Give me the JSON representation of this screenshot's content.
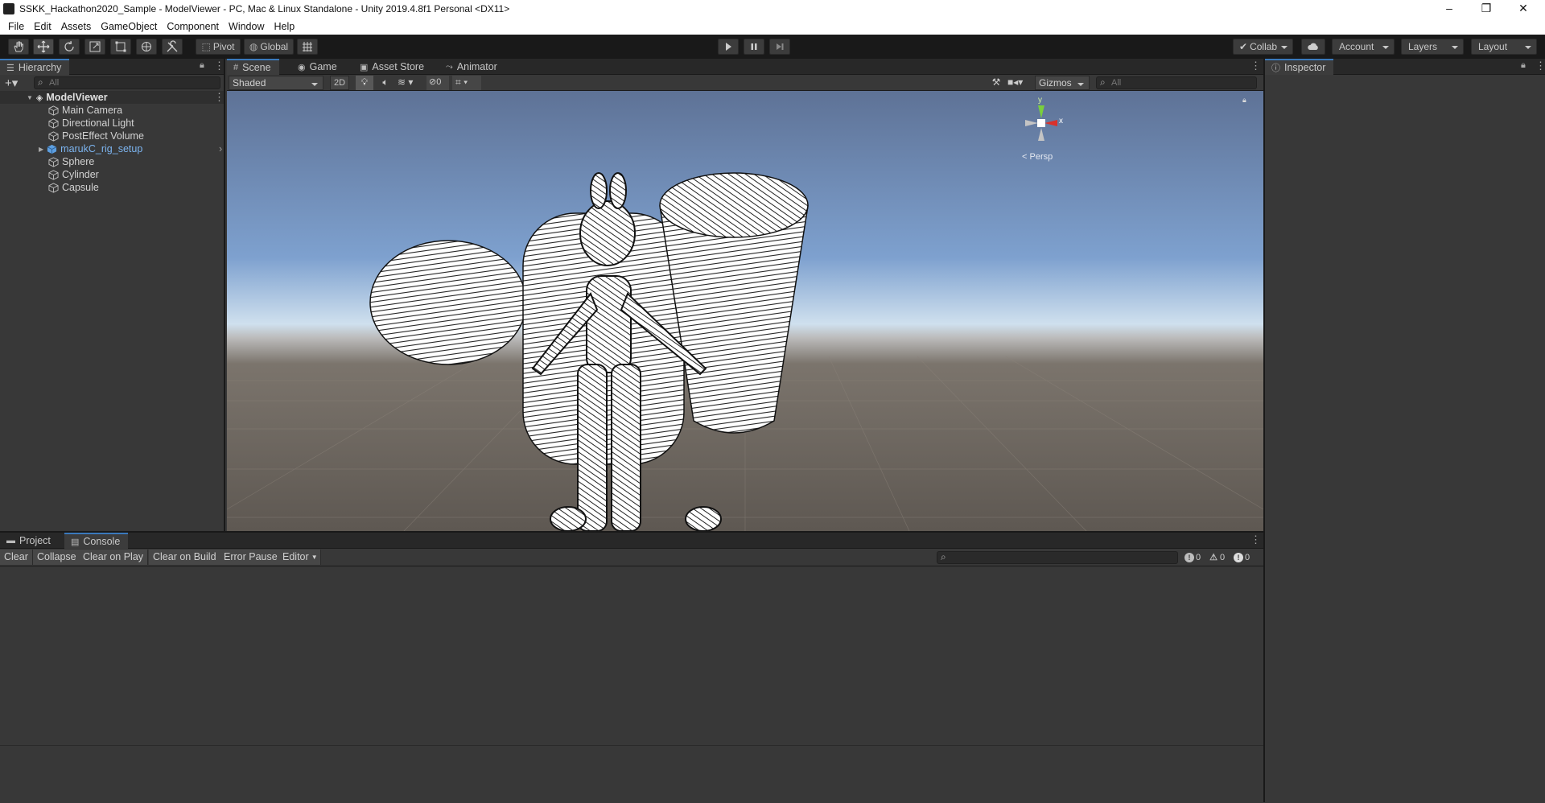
{
  "window": {
    "title": "SSKK_Hackathon2020_Sample - ModelViewer - PC, Mac & Linux Standalone - Unity 2019.4.8f1 Personal <DX11>",
    "controls": [
      "–",
      "❐",
      "✕"
    ]
  },
  "menu": [
    "File",
    "Edit",
    "Assets",
    "GameObject",
    "Component",
    "Window",
    "Help"
  ],
  "toolbar": {
    "tools": [
      "hand-tool-icon",
      "move-tool-icon",
      "rotate-tool-icon",
      "scale-tool-icon",
      "rect-tool-icon",
      "transform-tool-icon",
      "custom-tool-icon"
    ],
    "pivot": "Pivot",
    "global": "Global",
    "collab": "Collab",
    "account": "Account",
    "layers": "Layers",
    "layout": "Layout"
  },
  "hierarchy": {
    "tab": "Hierarchy",
    "search_placeholder": "All",
    "scene": "ModelViewer",
    "items": [
      "Main Camera",
      "Directional Light",
      "PostEffect Volume",
      "marukC_rig_setup",
      "Sphere",
      "Cylinder",
      "Capsule"
    ]
  },
  "scene": {
    "tabs": [
      "Scene",
      "Game",
      "Asset Store",
      "Animator"
    ],
    "shading": "Shaded",
    "mode_2d": "2D",
    "hidden_count": "0",
    "gizmos": "Gizmos",
    "search_placeholder": "All",
    "projection": "Persp",
    "axes": {
      "y": "y",
      "x": "x"
    }
  },
  "inspector": {
    "tab": "Inspector"
  },
  "console": {
    "tabs": [
      "Project",
      "Console"
    ],
    "buttons": [
      "Clear",
      "Collapse",
      "Clear on Play",
      "Clear on Build",
      "Error Pause",
      "Editor"
    ],
    "log_count": "0",
    "warn_count": "0",
    "error_count": "0"
  },
  "colors": {
    "accent": "#3a79bb",
    "prefab_text": "#7cb4ef",
    "sky_top": "#5e7296",
    "ground": "#5e5852"
  }
}
